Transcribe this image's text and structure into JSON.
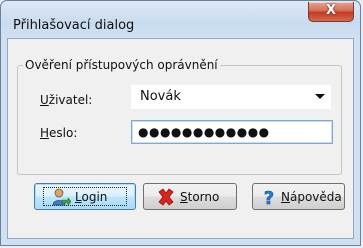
{
  "window": {
    "title": "Přihlašovací dialog",
    "close_glyph": "X"
  },
  "group": {
    "legend": "Ověření přístupových oprávnění"
  },
  "user": {
    "label": "Uživatel:",
    "value": "Novák"
  },
  "password": {
    "label": "Heslo:",
    "masked": "●●●●●●●●●●●●"
  },
  "buttons": {
    "login": "Login",
    "cancel": "Storno",
    "help": "Nápověda"
  },
  "icons": {
    "login": "user-arrow-icon",
    "cancel": "red-x-icon",
    "help": "question-mark-icon"
  },
  "colors": {
    "client_bg": "#f0f0f0",
    "title_bg": "#cfe0f2",
    "accent": "#3c7fb1"
  }
}
